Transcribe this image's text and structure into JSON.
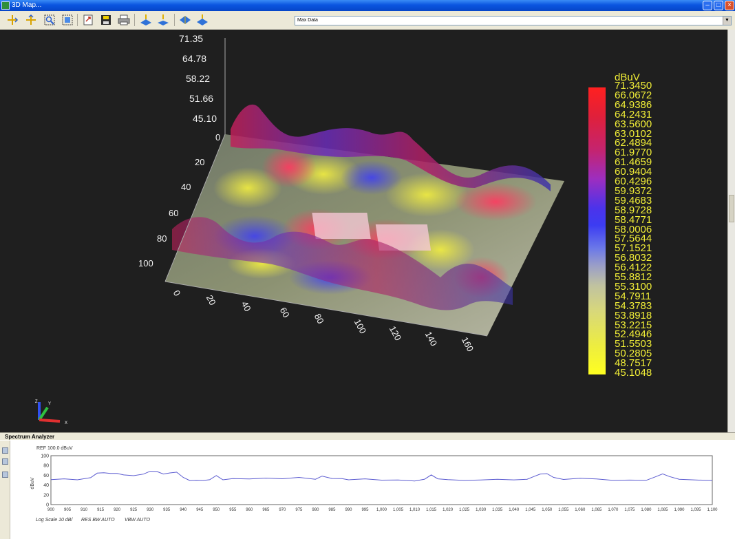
{
  "window": {
    "title": "3D Map..."
  },
  "toolbar": {
    "buttons": [
      "axis-x-icon",
      "axis-y-icon",
      "zoom-region-icon",
      "zoom-fit-icon",
      "export-icon",
      "save-icon",
      "print-icon",
      "layer-up-icon",
      "layer-down-icon",
      "surface-top-icon",
      "surface-bottom-icon"
    ],
    "view_select": {
      "value": "Max Data"
    }
  },
  "map3d": {
    "z_ticks": [
      "71.35",
      "64.78",
      "58.22",
      "51.66",
      "45.10"
    ],
    "y_ticks": [
      "0",
      "20",
      "40",
      "60",
      "80",
      "100"
    ],
    "x_ticks": [
      "0",
      "20",
      "40",
      "60",
      "80",
      "100",
      "120",
      "140",
      "160"
    ],
    "axis_triad": {
      "x": "X",
      "y": "Y",
      "z": "Z"
    },
    "colorbar": {
      "unit": "dBuV",
      "values": [
        "71.3450",
        "66.0672",
        "64.9386",
        "64.2431",
        "63.5600",
        "63.0102",
        "62.4894",
        "61.9770",
        "61.4659",
        "60.9404",
        "60.4296",
        "59.9372",
        "59.4683",
        "58.9728",
        "58.4771",
        "58.0006",
        "57.5644",
        "57.1521",
        "56.8032",
        "56.4122",
        "55.8812",
        "55.3100",
        "54.7911",
        "54.3783",
        "53.8918",
        "53.2215",
        "52.4946",
        "51.5503",
        "50.2805",
        "48.7517",
        "45.1048"
      ],
      "colors": {
        "top": "#ff2020",
        "middle": "#3c3cf2",
        "bottom": "#ffff20",
        "label": "#f1ee37"
      }
    }
  },
  "spectrum": {
    "panel_title": "Spectrum Analyzer",
    "sidebar_icons": [
      "copy-icon",
      "save-icon",
      "print-icon"
    ],
    "ref_label": "REF 100.0 dBuV",
    "footer": {
      "scale": "Log Scale 10 dB/",
      "rbw": "RES BW AUTO",
      "vbw": "VBW AUTO"
    },
    "chart_data": {
      "type": "line",
      "ylabel": "dBuV",
      "ylim": [
        0,
        100
      ],
      "yticks": [
        "0",
        "20",
        "40",
        "60",
        "80",
        "100"
      ],
      "xlim": [
        900,
        1100
      ],
      "xticks": [
        "900",
        "905",
        "910",
        "915",
        "920",
        "925",
        "930",
        "935",
        "940",
        "945",
        "950",
        "955",
        "960",
        "965",
        "970",
        "975",
        "980",
        "985",
        "990",
        "995",
        "1,000",
        "1,005",
        "1,010",
        "1,015",
        "1,020",
        "1,025",
        "1,030",
        "1,035",
        "1,040",
        "1,045",
        "1,050",
        "1,055",
        "1,060",
        "1,065",
        "1,070",
        "1,075",
        "1,080",
        "1,085",
        "1,090",
        "1,095",
        "1,100"
      ],
      "grid": false,
      "line_color": "#5a5ad0",
      "series": [
        {
          "x": [
            900,
            904,
            908,
            912,
            914,
            916,
            918,
            920,
            922,
            925,
            928,
            930,
            932,
            934,
            936,
            938,
            940,
            942,
            944,
            946,
            948,
            950,
            952,
            955,
            960,
            965,
            970,
            975,
            980,
            982,
            985,
            988,
            990,
            995,
            1000,
            1005,
            1010,
            1013,
            1015,
            1017,
            1020,
            1025,
            1030,
            1035,
            1040,
            1044,
            1046,
            1048,
            1050,
            1052,
            1055,
            1060,
            1065,
            1070,
            1075,
            1080,
            1083,
            1085,
            1087,
            1090,
            1095,
            1100
          ],
          "y": [
            51,
            52,
            50,
            55,
            65,
            66,
            64,
            63,
            60,
            59,
            63,
            69,
            68,
            62,
            64,
            66,
            56,
            50,
            50,
            49,
            50,
            59,
            51,
            54,
            53,
            54,
            52,
            55,
            52,
            59,
            54,
            53,
            50,
            52,
            50,
            51,
            49,
            52,
            60,
            52,
            51,
            50,
            51,
            52,
            50,
            51,
            57,
            63,
            64,
            56,
            51,
            53,
            52,
            50,
            51,
            50,
            57,
            62,
            57,
            52,
            51,
            50
          ]
        }
      ]
    }
  }
}
